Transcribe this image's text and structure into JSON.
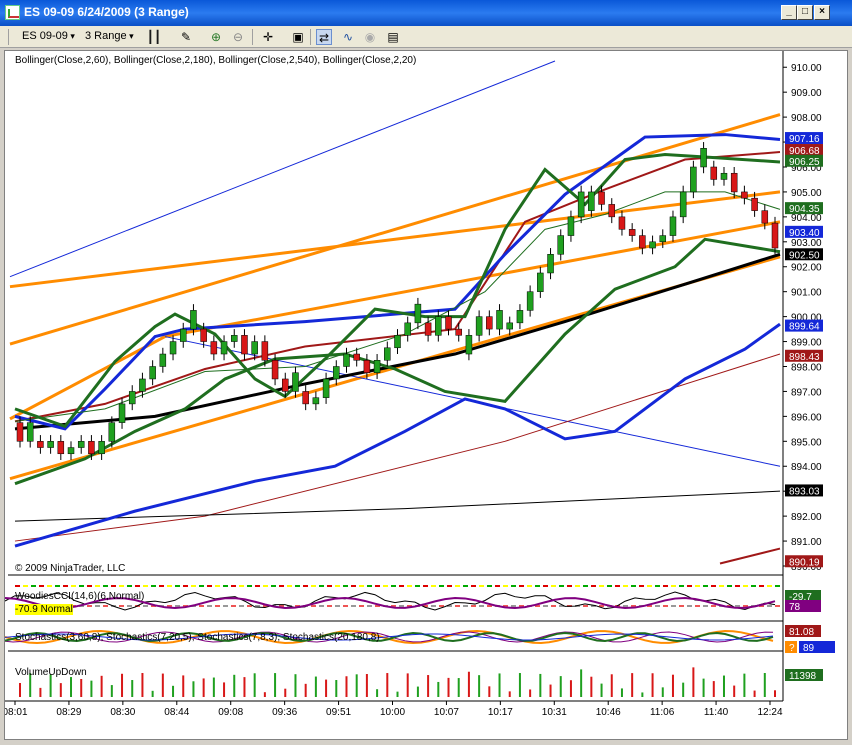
{
  "window": {
    "title": "ES 09-09  6/24/2009 (3 Range)",
    "min": "_",
    "max": "□",
    "close": "×"
  },
  "toolbar": {
    "instrument": "ES 09-09",
    "period": "3 Range"
  },
  "colors": {
    "orange": "#ff8c00",
    "darkgreen": "#1f6e1f",
    "darkred": "#a01818",
    "blue": "#1428d8",
    "black": "#000000",
    "up": "#1fa01f",
    "down": "#d81818",
    "titlebar": "#0a58d8"
  },
  "indicators": "Bollinger(Close,2,60), Bollinger(Close,2,180), Bollinger(Close,2,540), Bollinger(Close,2,20)",
  "copyright": "© 2009 NinjaTrader, LLC",
  "woodies": {
    "label": "WoodiesCCI(14,6)(6,Normal)",
    "value_label": "-70.9 Normal",
    "badge": "-29.7",
    "badge2": "78"
  },
  "stochastics": {
    "label": "Stochastics(3,60,8), Stochastics(7,20,5), Stochastics(7,8,3), Stochastics(20,180,8)",
    "badge1": "81.08",
    "badge2": "?",
    "badge3": "89"
  },
  "volume": {
    "label": "VolumeUpDown",
    "badge": "11398"
  },
  "price_axis": {
    "ticks": [
      "910.00",
      "909.00",
      "908.00",
      "907.00",
      "906.00",
      "905.00",
      "904.00",
      "903.00",
      "902.00",
      "901.00",
      "900.00",
      "899.00",
      "898.00",
      "897.00",
      "896.00",
      "895.00",
      "894.00",
      "893.00",
      "892.00",
      "891.00",
      "890.00"
    ],
    "badges": [
      {
        "text": "907.16",
        "color": "#1428d8",
        "value": 907.16
      },
      {
        "text": "906.68",
        "color": "#a01818",
        "value": 906.68
      },
      {
        "text": "906.25",
        "color": "#1f6e1f",
        "value": 906.25
      },
      {
        "text": "904.35",
        "color": "#1f6e1f",
        "value": 904.35
      },
      {
        "text": "903.40",
        "color": "#1428d8",
        "value": 903.4
      },
      {
        "text": "902.50",
        "color": "#000000",
        "value": 902.5
      },
      {
        "text": "899.64",
        "color": "#1428d8",
        "value": 899.64
      },
      {
        "text": "898.43",
        "color": "#a01818",
        "value": 898.43
      },
      {
        "text": "893.03",
        "color": "#000000",
        "value": 893.03
      },
      {
        "text": "890.19",
        "color": "#a01818",
        "value": 890.19
      }
    ]
  },
  "time_axis": [
    "08:01",
    "08:29",
    "08:30",
    "08:44",
    "09:08",
    "09:36",
    "09:51",
    "10:00",
    "10:07",
    "10:17",
    "10:31",
    "10:46",
    "11:06",
    "11:40",
    "12:24"
  ],
  "chart_data": {
    "type": "candlestick",
    "ylim": [
      890,
      910.25
    ],
    "bar_count": 75,
    "closes": [
      895,
      895,
      894.75,
      895,
      894.5,
      894.75,
      895,
      894.5,
      895,
      895.75,
      896.5,
      897,
      897.5,
      898,
      898.5,
      899,
      899.5,
      899.5,
      899,
      898.5,
      899,
      899.25,
      898.5,
      899,
      898.25,
      897.5,
      897,
      897,
      896.5,
      896.75,
      897.5,
      898,
      898.5,
      898.25,
      897.75,
      898.25,
      898.75,
      899.25,
      899.75,
      899.75,
      899.25,
      900,
      899.5,
      899.25,
      899.25,
      900,
      899.5,
      899.5,
      899.75,
      900.25,
      901,
      901.75,
      902.5,
      903.25,
      904,
      905,
      905,
      904.5,
      904,
      903.5,
      903.25,
      902.75,
      903,
      903.25,
      904,
      905,
      906,
      906,
      905.5,
      905.75,
      905,
      904.75,
      904.25,
      903.75,
      902.75
    ]
  }
}
